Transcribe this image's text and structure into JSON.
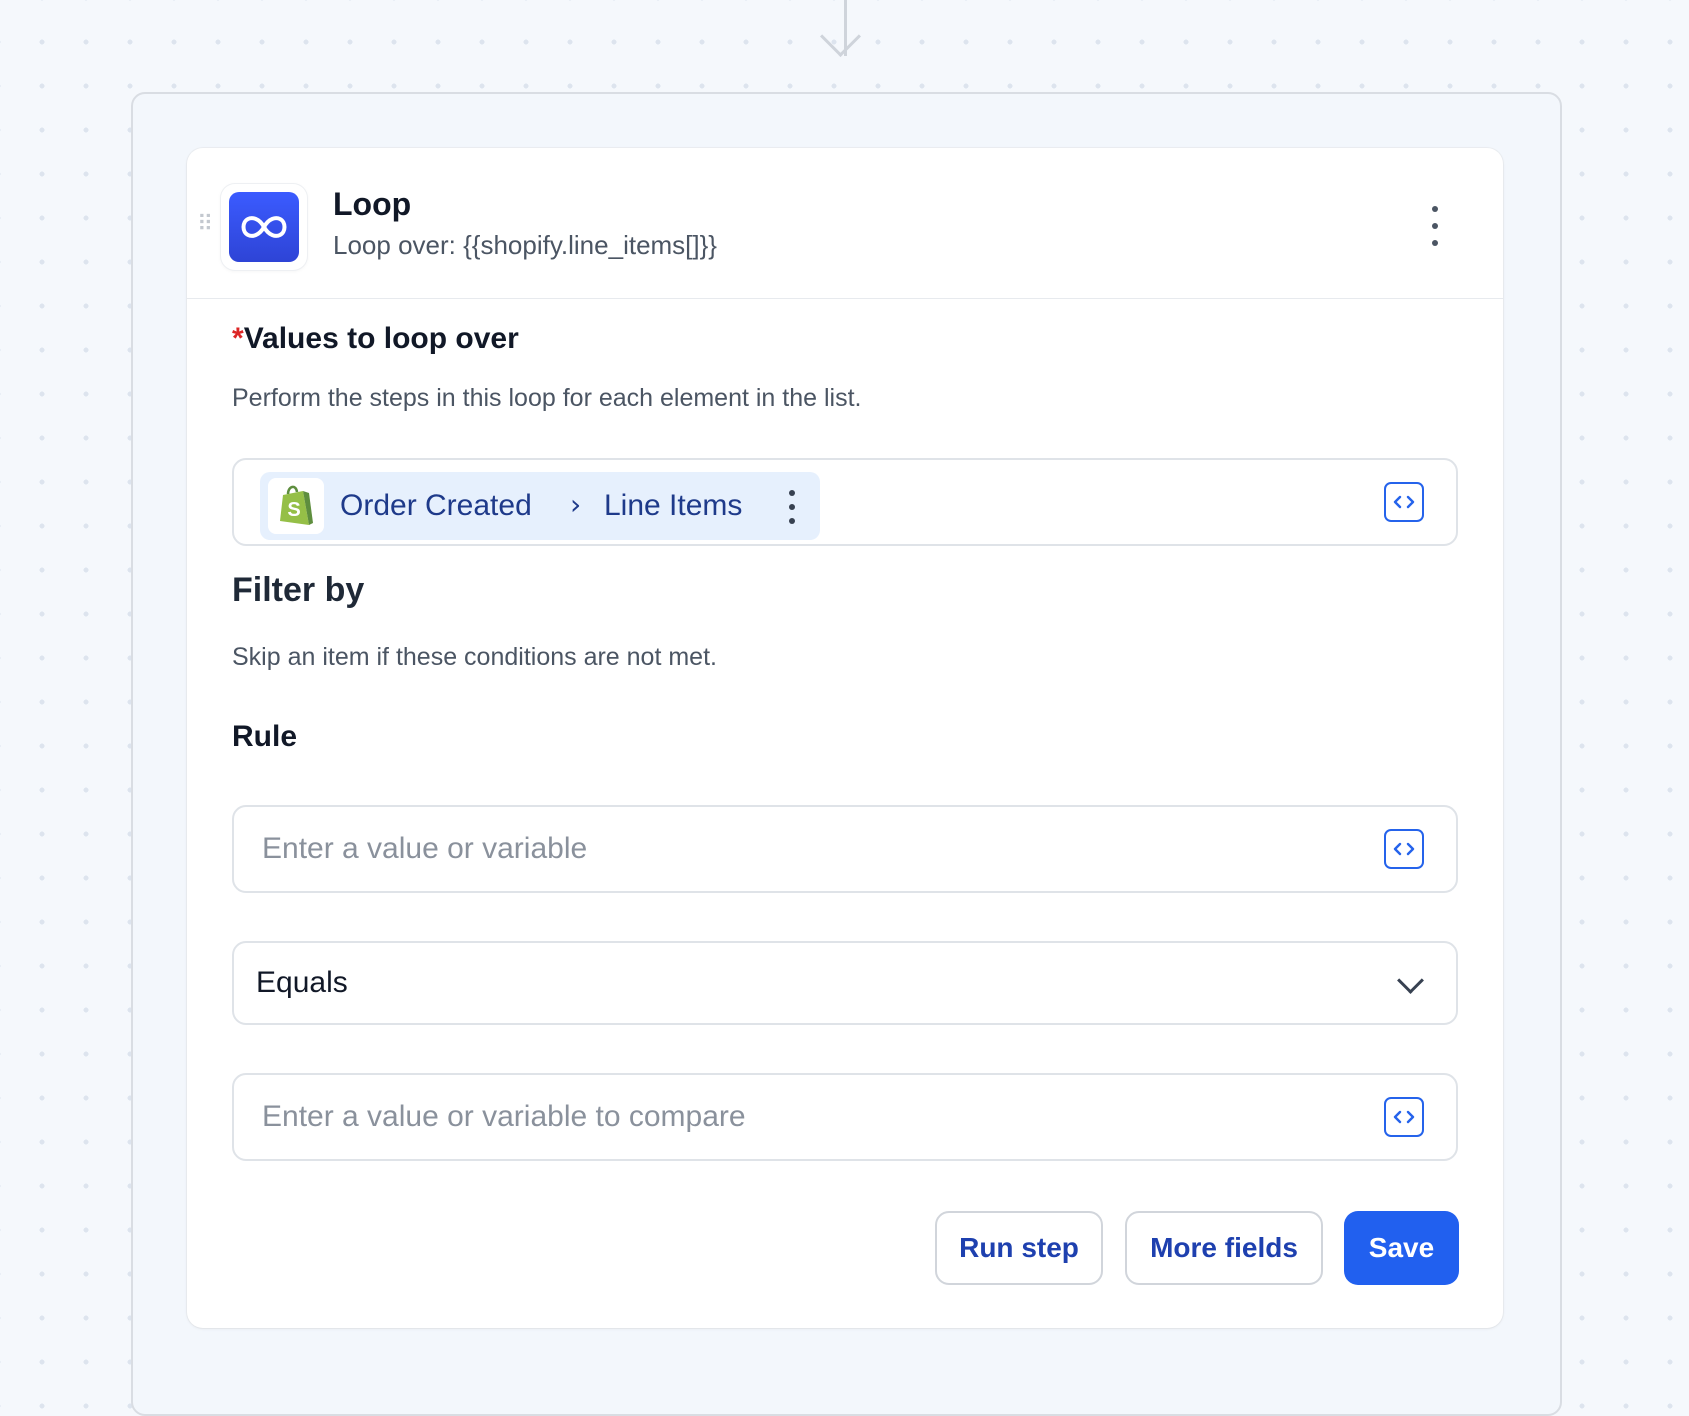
{
  "step": {
    "title": "Loop",
    "subtitle": "Loop over: {{shopify.line_items[]}}",
    "icon": "infinity-icon",
    "accent": "#3453f0"
  },
  "values_field": {
    "required_marker": "*",
    "label": "Values to loop over",
    "helper": "Perform the steps in this loop for each element in the list.",
    "chip": {
      "source_icon": "shopify-icon",
      "source": "Order Created",
      "separator": "›",
      "field": "Line Items"
    }
  },
  "filter": {
    "title": "Filter by",
    "helper": "Skip an item if these conditions are not met.",
    "rule_label": "Rule",
    "rule_value_placeholder": "Enter a value or variable",
    "operator": "Equals",
    "compare_placeholder": "Enter a value or variable to compare"
  },
  "actions": {
    "run_step": "Run step",
    "more_fields": "More fields",
    "save": "Save"
  },
  "colors": {
    "primary": "#2160ef",
    "link_text": "#1e40af",
    "required": "#dc2626",
    "chip_bg": "#e6f0fd"
  }
}
